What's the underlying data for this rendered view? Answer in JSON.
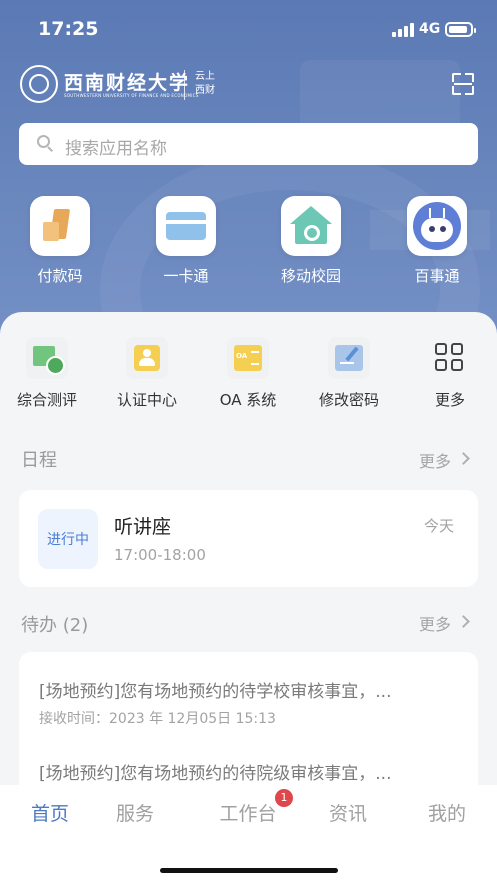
{
  "status_bar": {
    "time": "17:25",
    "network": "4G"
  },
  "header": {
    "school_name": "西南财经大学",
    "school_name_en": "SOUTHWESTERN UNIVERSITY OF FINANCE AND ECONOMICS",
    "app_line1": "云上",
    "app_line2": "西财",
    "scan_icon": "scan-icon"
  },
  "search": {
    "placeholder": "搜索应用名称"
  },
  "quick_apps": [
    {
      "label": "付款码",
      "icon": "payment-code-icon"
    },
    {
      "label": "一卡通",
      "icon": "campus-card-icon"
    },
    {
      "label": "移动校园",
      "icon": "mobile-campus-icon"
    },
    {
      "label": "百事通",
      "icon": "assistant-bot-icon"
    }
  ],
  "services": [
    {
      "label": "综合测评",
      "icon": "evaluation-icon"
    },
    {
      "label": "认证中心",
      "icon": "auth-center-icon"
    },
    {
      "label": "OA 系统",
      "icon": "oa-system-icon"
    },
    {
      "label": "修改密码",
      "icon": "change-password-icon"
    },
    {
      "label": "更多",
      "icon": "grid-more-icon"
    }
  ],
  "schedule": {
    "title": "日程",
    "more": "更多",
    "event": {
      "status": "进行中",
      "title": "听讲座",
      "time": "17:00-18:00",
      "day": "今天"
    }
  },
  "todo": {
    "title": "待办 (2)",
    "more": "更多",
    "items": [
      {
        "title": "[场地预约]您有场地预约的待学校审核事宜，...",
        "time": "接收时间：2023 年 12月05日 15:13"
      },
      {
        "title": "[场地预约]您有场地预约的待院级审核事宜，..."
      }
    ]
  },
  "tabbar": {
    "tabs": [
      "首页",
      "服务",
      "工作台",
      "资讯",
      "我的"
    ],
    "active_index": 0,
    "workbench_badge": "1"
  },
  "colors": {
    "header_blue": "#6383bd",
    "accent": "#4c79c4",
    "badge_red": "#e0474c"
  }
}
